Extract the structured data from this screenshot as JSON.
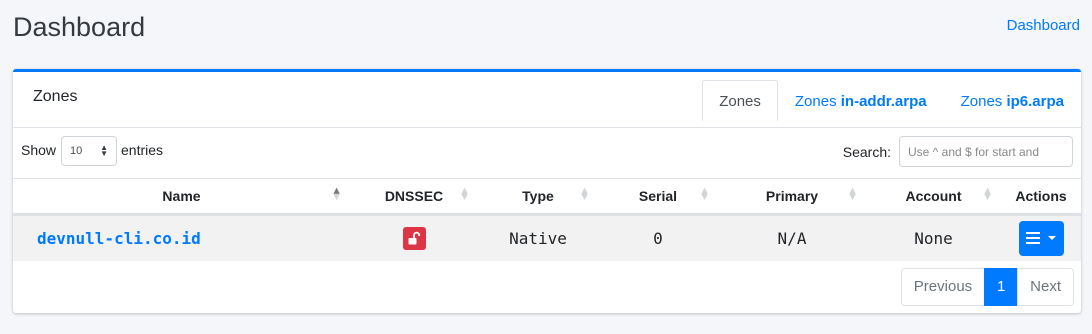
{
  "page": {
    "title": "Dashboard",
    "breadcrumb": "Dashboard"
  },
  "card": {
    "title": "Zones",
    "tabs": [
      {
        "prefix": "Zones",
        "suffix": "",
        "active": true
      },
      {
        "prefix": "Zones ",
        "suffix": "in-addr.arpa",
        "active": false
      },
      {
        "prefix": "Zones ",
        "suffix": "ip6.arpa",
        "active": false
      }
    ]
  },
  "controls": {
    "show_label": "Show",
    "entries_value": "10",
    "entries_label": "entries",
    "search_label": "Search:",
    "search_placeholder": "Use ^ and $ for start and"
  },
  "table": {
    "columns": [
      "Name",
      "DNSSEC",
      "Type",
      "Serial",
      "Primary",
      "Account",
      "Actions"
    ],
    "rows": [
      {
        "name": "devnull-cli.co.id",
        "dnssec": "unlocked-icon",
        "type": "Native",
        "serial": "0",
        "primary": "N/A",
        "account": "None"
      }
    ]
  },
  "pagination": {
    "previous": "Previous",
    "current": "1",
    "next": "Next"
  },
  "colors": {
    "primary": "#007bff",
    "danger": "#dc3545",
    "background": "#f4f6f9"
  }
}
